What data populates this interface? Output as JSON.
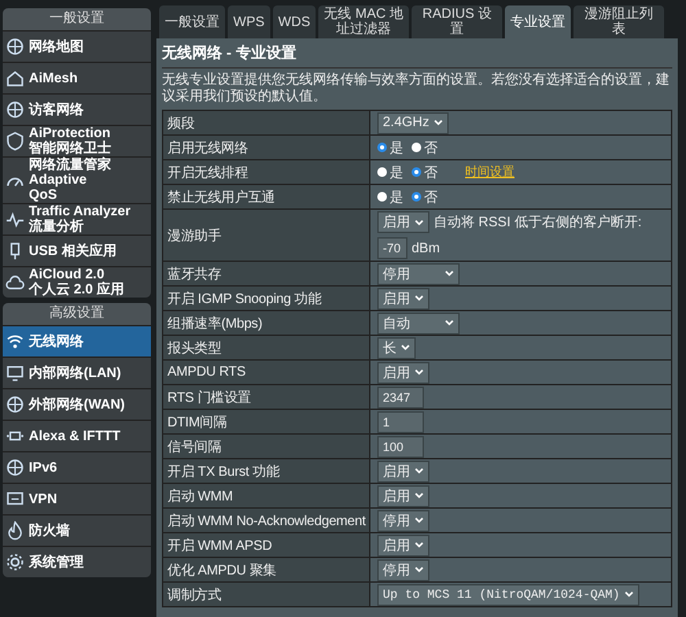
{
  "sidebar": {
    "sections": [
      {
        "title": "一般设置",
        "items": [
          {
            "lines": [
              "网络地图"
            ],
            "selected": false
          },
          {
            "lines": [
              "AiMesh"
            ],
            "selected": false
          },
          {
            "lines": [
              "访客网络"
            ],
            "selected": false
          },
          {
            "lines": [
              "AiProtection",
              "智能网络卫士"
            ],
            "selected": false
          },
          {
            "lines": [
              "网络流量管家 Adaptive",
              "QoS"
            ],
            "selected": false
          },
          {
            "lines": [
              "Traffic Analyzer",
              "流量分析"
            ],
            "selected": false
          },
          {
            "lines": [
              "USB 相关应用"
            ],
            "selected": false
          },
          {
            "lines": [
              "AiCloud 2.0",
              "个人云 2.0 应用"
            ],
            "selected": false
          }
        ]
      },
      {
        "title": "高级设置",
        "items": [
          {
            "lines": [
              "无线网络"
            ],
            "selected": true
          },
          {
            "lines": [
              "内部网络(LAN)"
            ],
            "selected": false
          },
          {
            "lines": [
              "外部网络(WAN)"
            ],
            "selected": false
          },
          {
            "lines": [
              "Alexa & IFTTT"
            ],
            "selected": false
          },
          {
            "lines": [
              "IPv6"
            ],
            "selected": false
          },
          {
            "lines": [
              "VPN"
            ],
            "selected": false
          },
          {
            "lines": [
              "防火墙"
            ],
            "selected": false
          },
          {
            "lines": [
              "系统管理"
            ],
            "selected": false
          }
        ]
      }
    ]
  },
  "tabs": [
    {
      "label": "一般设置",
      "selected": false
    },
    {
      "label": "WPS",
      "selected": false
    },
    {
      "label": "WDS",
      "selected": false
    },
    {
      "label": "无线 MAC 地址过滤器",
      "selected": false
    },
    {
      "label": "RADIUS 设置",
      "selected": false
    },
    {
      "label": "专业设置",
      "selected": true
    },
    {
      "label": "漫游阻止列表",
      "selected": false
    }
  ],
  "page": {
    "title": "无线网络 - 专业设置",
    "description": "无线专业设置提供您无线网络传输与效率方面的设置。若您没有选择适合的设置，建议采用我们预设的默认值。"
  },
  "settings": [
    {
      "label": "频段",
      "kind": "select",
      "value": "2.4GHz"
    },
    {
      "label": "启用无线网络",
      "kind": "radio",
      "options": [
        {
          "label": "是",
          "selected": true
        },
        {
          "label": "否",
          "selected": false
        }
      ]
    },
    {
      "label": "开启无线排程",
      "kind": "radio",
      "options": [
        {
          "label": "是",
          "selected": false
        },
        {
          "label": "否",
          "selected": true
        }
      ],
      "link": "时间设置"
    },
    {
      "label": "禁止无线用户互通",
      "kind": "radio",
      "options": [
        {
          "label": "是",
          "selected": false
        },
        {
          "label": "否",
          "selected": true
        }
      ]
    },
    {
      "label": "漫游助手",
      "kind": "roam",
      "value": "启用",
      "text": "自动将 RSSI 低于右侧的客户断开:",
      "input": "-70",
      "unit": "dBm"
    },
    {
      "label": "蓝牙共存",
      "kind": "select",
      "value": "停用",
      "wide": true
    },
    {
      "label": "开启 IGMP Snooping 功能",
      "kind": "select",
      "value": "启用"
    },
    {
      "label": "组播速率(Mbps)",
      "kind": "select",
      "value": "自动",
      "wide": true
    },
    {
      "label": "报头类型",
      "kind": "select",
      "value": "长"
    },
    {
      "label": "AMPDU RTS",
      "kind": "select",
      "value": "启用"
    },
    {
      "label": "RTS 门槛设置",
      "kind": "input",
      "value": "2347"
    },
    {
      "label": "DTIM间隔",
      "kind": "input",
      "value": "1"
    },
    {
      "label": "信号间隔",
      "kind": "input",
      "value": "100"
    },
    {
      "label": "开启 TX Burst 功能",
      "kind": "select",
      "value": "启用"
    },
    {
      "label": "启动 WMM",
      "kind": "select",
      "value": "启用"
    },
    {
      "label": "启动 WMM No-Acknowledgement",
      "kind": "select",
      "value": "停用"
    },
    {
      "label": "开启 WMM APSD",
      "kind": "select",
      "value": "启用"
    },
    {
      "label": "优化 AMPDU 聚集",
      "kind": "select",
      "value": "停用"
    },
    {
      "label": "调制方式",
      "kind": "select",
      "value": "Up to MCS 11 (NitroQAM/1024-QAM)",
      "mono": true
    }
  ]
}
